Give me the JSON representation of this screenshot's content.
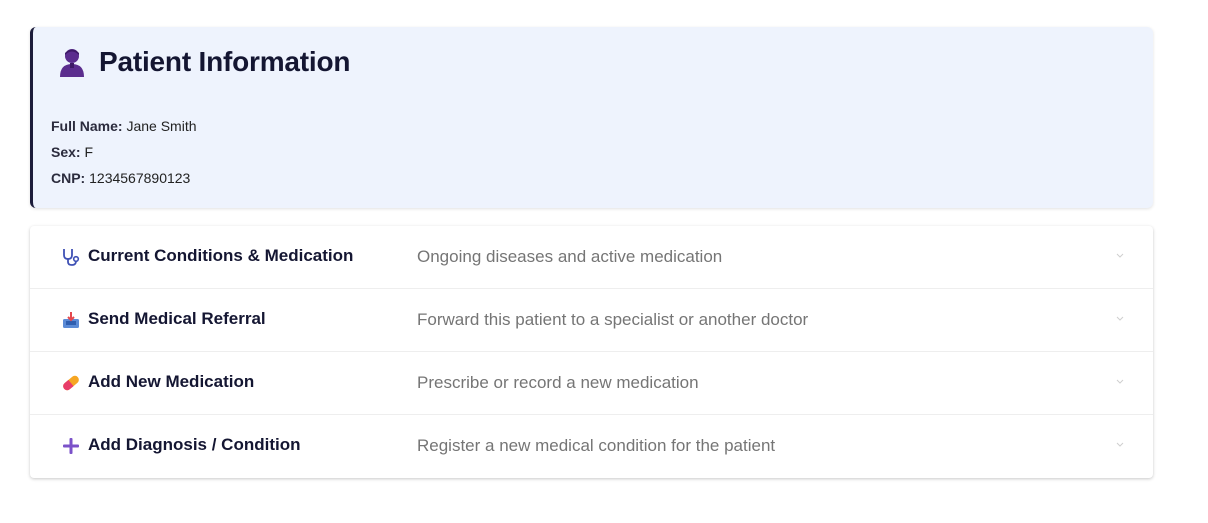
{
  "patient": {
    "title": "Patient Information",
    "icon": "person-icon",
    "fields": [
      {
        "label": "Full Name:",
        "value": "Jane Smith"
      },
      {
        "label": "Sex:",
        "value": "F"
      },
      {
        "label": "CNP:",
        "value": "1234567890123"
      }
    ]
  },
  "actions": [
    {
      "icon": "stethoscope-icon",
      "title": "Current Conditions & Medication",
      "description": "Ongoing diseases and active medication"
    },
    {
      "icon": "inbox-tray-icon",
      "title": "Send Medical Referral",
      "description": "Forward this patient to a specialist or another doctor"
    },
    {
      "icon": "pill-icon",
      "title": "Add New Medication",
      "description": "Prescribe or record a new medication"
    },
    {
      "icon": "plus-icon",
      "title": "Add Diagnosis / Condition",
      "description": "Register a new medical condition for the patient"
    }
  ],
  "colors": {
    "card_bg": "#eef3fd",
    "card_border": "#1c1c3a",
    "title": "#141632",
    "description": "#757575",
    "person_icon": "#5b2d8e",
    "plus_icon": "#7b52c9"
  }
}
